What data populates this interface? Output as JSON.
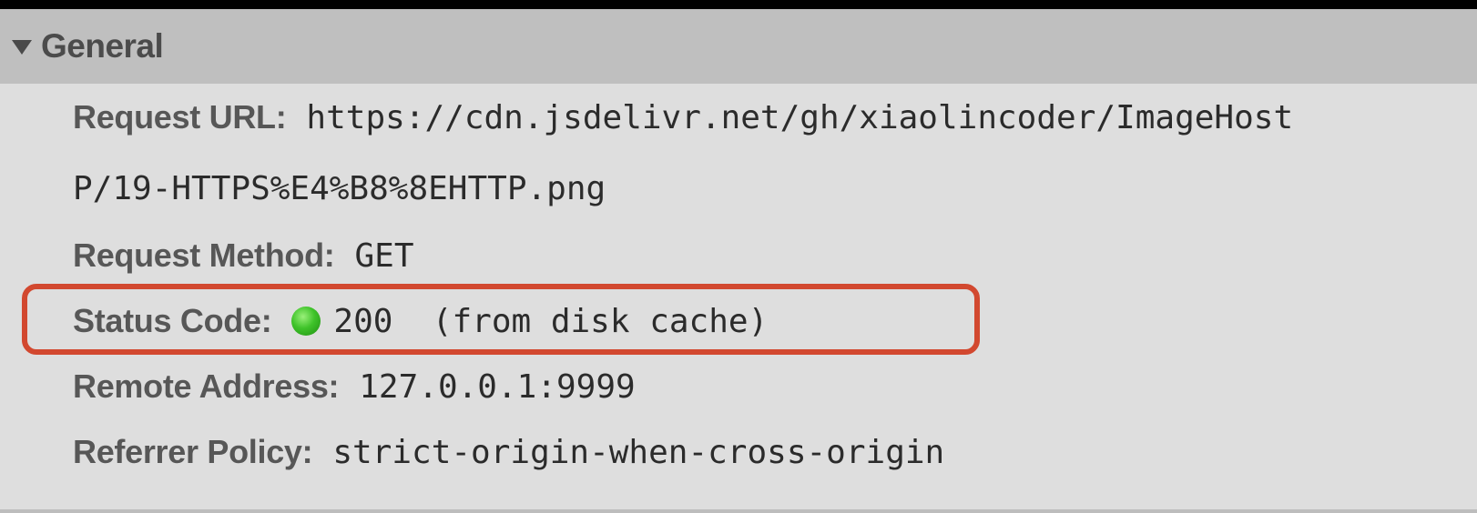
{
  "general": {
    "title": "General",
    "request_url": {
      "label": "Request URL:",
      "value_line1": "https://cdn.jsdelivr.net/gh/xiaolincoder/ImageHost",
      "value_line2": "P/19-HTTPS%E4%B8%8EHTTP.png"
    },
    "request_method": {
      "label": "Request Method:",
      "value": "GET"
    },
    "status_code": {
      "label": "Status Code:",
      "value": "200  (from disk cache)",
      "status_color": "#3fc32a",
      "highlight_color": "#d2482f"
    },
    "remote_address": {
      "label": "Remote Address:",
      "value": "127.0.0.1:9999"
    },
    "referrer_policy": {
      "label": "Referrer Policy:",
      "value": "strict-origin-when-cross-origin"
    }
  }
}
